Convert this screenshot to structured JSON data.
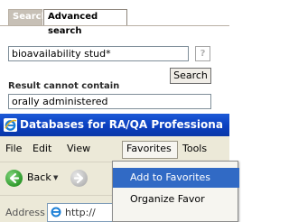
{
  "search_panel": {
    "tabs": [
      {
        "label": "Search",
        "active": false
      },
      {
        "label": "Advanced search",
        "active": true
      }
    ],
    "query_value": "bioavailability stud*",
    "help_label": "?",
    "search_button": "Search",
    "exclude_label": "Result cannot contain",
    "exclude_value": "orally administered"
  },
  "browser": {
    "title": "Databases for RA/QA Professiona",
    "menu": [
      "File",
      "Edit",
      "View",
      "Favorites",
      "Tools"
    ],
    "back_label": "Back",
    "address_label": "Address",
    "address_value": "http://",
    "favorites_menu": [
      "Add to Favorites",
      "Organize Favor"
    ]
  },
  "colors": {
    "titlebar": "#0b3fbf",
    "menu_highlight": "#316ac5",
    "tab_inactive": "#c7c0b6"
  }
}
